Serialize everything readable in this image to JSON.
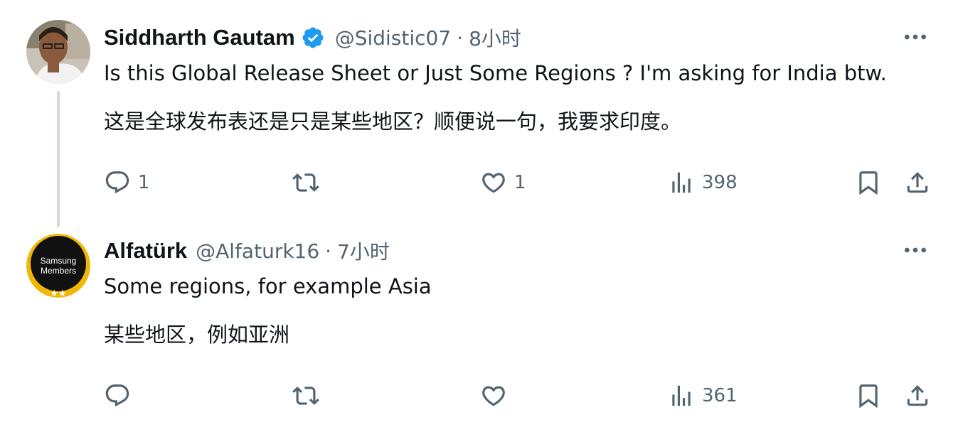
{
  "tweets": [
    {
      "display_name": "Siddharth Gautam",
      "verified": true,
      "handle": "@Sidistic07",
      "separator": "·",
      "time": "8小时",
      "text": "Is this Global Release Sheet or Just Some Regions ? I'm asking for India btw.",
      "translation": "这是全球发布表还是只是某些地区？顺便说一句，我要求印度。",
      "replies": "1",
      "reposts": "",
      "likes": "1",
      "views": "398",
      "avatar_icon": "user-photo-avatar"
    },
    {
      "display_name": "Alfatürk",
      "verified": false,
      "handle": "@Alfaturk16",
      "separator": "·",
      "time": "7小时",
      "text": "Some regions, for example Asia",
      "translation": "某些地区，例如亚洲",
      "replies": "",
      "reposts": "",
      "likes": "",
      "views": "361",
      "avatar_icon": "samsung-members-avatar",
      "avatar_label_1": "Samsung",
      "avatar_label_2": "Members",
      "avatar_stars": "★★"
    }
  ],
  "colors": {
    "text_primary": "#0f1419",
    "text_secondary": "#536471",
    "verified_blue": "#1d9bf0",
    "thread_line": "#cfd9de",
    "badge_gold": "#f2b705"
  }
}
